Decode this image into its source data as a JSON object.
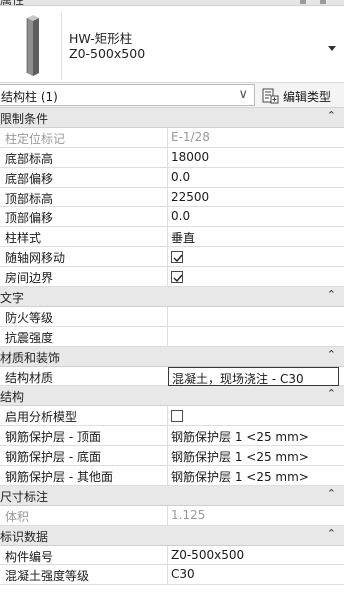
{
  "panel": {
    "title": "属性"
  },
  "type_selector": {
    "family": "HW-矩形柱",
    "type": "Z0-500x500"
  },
  "filter": {
    "label": "结构柱 (1)",
    "edit_type_label": "编辑类型"
  },
  "sections": [
    {
      "label": "限制条件",
      "collapse": "⌃",
      "rows": [
        {
          "name": "柱定位标记",
          "value": "E-1/28",
          "kind": "text",
          "gray": true
        },
        {
          "name": "底部标高",
          "value": "18000",
          "kind": "text"
        },
        {
          "name": "底部偏移",
          "value": "0.0",
          "kind": "text"
        },
        {
          "name": "顶部标高",
          "value": "22500",
          "kind": "text"
        },
        {
          "name": "顶部偏移",
          "value": "0.0",
          "kind": "text"
        },
        {
          "name": "柱样式",
          "value": "垂直",
          "kind": "text"
        },
        {
          "name": "随轴网移动",
          "value": true,
          "kind": "checkbox"
        },
        {
          "name": "房间边界",
          "value": true,
          "kind": "checkbox"
        }
      ]
    },
    {
      "label": "文字",
      "collapse": "⌃",
      "rows": [
        {
          "name": "防火等级",
          "value": "",
          "kind": "text"
        },
        {
          "name": "抗震强度",
          "value": "",
          "kind": "text"
        }
      ]
    },
    {
      "label": "材质和装饰",
      "collapse": "⌃",
      "rows": [
        {
          "name": "结构材质",
          "value": "混凝土，现场浇注 - C30",
          "kind": "text",
          "active": true
        }
      ]
    },
    {
      "label": "结构",
      "collapse": "⌃",
      "rows": [
        {
          "name": "启用分析模型",
          "value": false,
          "kind": "checkbox"
        },
        {
          "name": "钢筋保护层 - 顶面",
          "value": "钢筋保护层 1 <25 mm>",
          "kind": "text"
        },
        {
          "name": "钢筋保护层 - 底面",
          "value": "钢筋保护层 1 <25 mm>",
          "kind": "text"
        },
        {
          "name": "钢筋保护层 - 其他面",
          "value": "钢筋保护层 1 <25 mm>",
          "kind": "text"
        }
      ]
    },
    {
      "label": "尺寸标注",
      "collapse": "⌃",
      "rows": [
        {
          "name": "体积",
          "value": "1.125",
          "kind": "text",
          "gray": true
        }
      ]
    },
    {
      "label": "标识数据",
      "collapse": "⌃",
      "rows": [
        {
          "name": "构件编号",
          "value": "Z0-500x500",
          "kind": "text"
        },
        {
          "name": "混凝土强度等级",
          "value": "C30",
          "kind": "text"
        }
      ]
    }
  ]
}
